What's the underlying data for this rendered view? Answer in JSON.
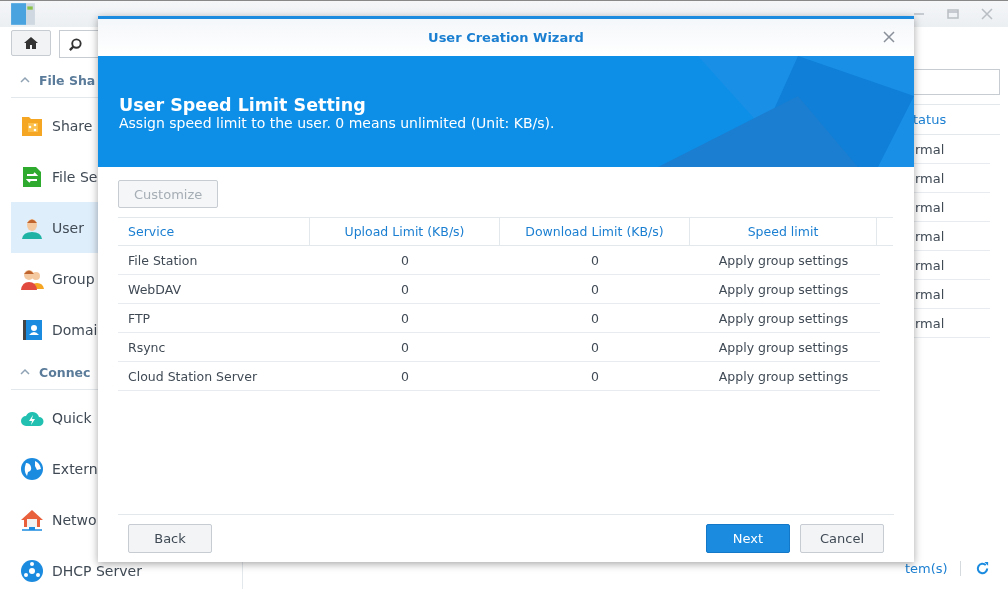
{
  "sidebar": {
    "sections": [
      {
        "label": "File Sha",
        "expanded": true,
        "items": [
          {
            "label": "Share",
            "kind": "shared-folder",
            "selected": false
          },
          {
            "label": "File Se",
            "kind": "file-services",
            "selected": false
          },
          {
            "label": "User",
            "kind": "user",
            "selected": true
          },
          {
            "label": "Group",
            "kind": "group",
            "selected": false
          },
          {
            "label": "Domai",
            "kind": "domain",
            "selected": false
          }
        ]
      },
      {
        "label": "Connec",
        "expanded": true,
        "items": [
          {
            "label": "Quick",
            "kind": "cloud",
            "selected": false
          },
          {
            "label": "Extern",
            "kind": "globe",
            "selected": false
          },
          {
            "label": "Netwo",
            "kind": "network",
            "selected": false
          },
          {
            "label": "DHCP Server",
            "kind": "dhcp",
            "selected": false
          }
        ]
      }
    ]
  },
  "list": {
    "column_1": "tatus",
    "rows": [
      "rmal",
      "rmal",
      "rmal",
      "rmal",
      "rmal",
      "rmal",
      "rmal"
    ],
    "item_count": "tem(s)"
  },
  "dialog": {
    "title": "User Creation Wizard",
    "heading": "User Speed Limit Setting",
    "description": "Assign speed limit to the user. 0 means unlimited (Unit: KB/s).",
    "customize_button": {
      "label": "Customize",
      "disabled": true
    },
    "table": {
      "columns": [
        "Service",
        "Upload Limit (KB/s)",
        "Download Limit (KB/s)",
        "Speed limit"
      ],
      "rows": [
        {
          "service": "File Station",
          "upload": "0",
          "download": "0",
          "speed_limit": "Apply group settings"
        },
        {
          "service": "WebDAV",
          "upload": "0",
          "download": "0",
          "speed_limit": "Apply group settings"
        },
        {
          "service": "FTP",
          "upload": "0",
          "download": "0",
          "speed_limit": "Apply group settings"
        },
        {
          "service": "Rsync",
          "upload": "0",
          "download": "0",
          "speed_limit": "Apply group settings"
        },
        {
          "service": "Cloud Station Server",
          "upload": "0",
          "download": "0",
          "speed_limit": "Apply group settings"
        }
      ]
    },
    "buttons": [
      {
        "label": "Back",
        "primary": false
      },
      {
        "label": "Next",
        "primary": true
      },
      {
        "label": "Cancel",
        "primary": false
      }
    ]
  }
}
